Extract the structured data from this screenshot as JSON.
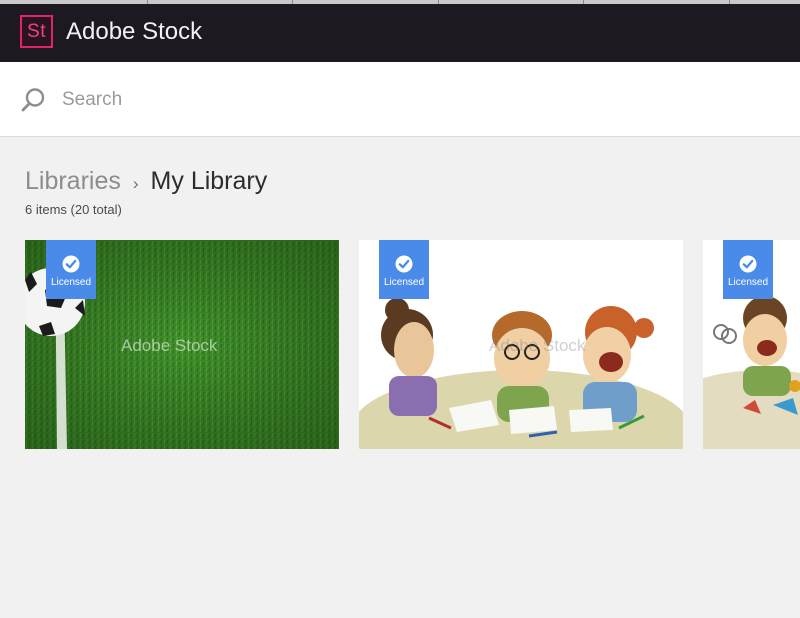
{
  "app": {
    "logo_text": "St",
    "title": "Adobe Stock",
    "brand_color": "#e0246c",
    "bar_color": "#1c1a20"
  },
  "search": {
    "placeholder": "Search",
    "value": ""
  },
  "breadcrumb": {
    "root": "Libraries",
    "separator": "›",
    "current": "My Library"
  },
  "library": {
    "count_text": "6 items (20 total)"
  },
  "assets": [
    {
      "badge": "Licensed",
      "watermark": "Adobe Stock",
      "subject": "soccer ball on grass"
    },
    {
      "badge": "Licensed",
      "watermark": "Adobe Stock",
      "subject": "children drawing illustration"
    },
    {
      "badge": "Licensed",
      "watermark": "",
      "subject": "child with scissors illustration"
    }
  ],
  "badge_color": "#4a8bea",
  "icons": [
    "search-icon",
    "check-icon"
  ]
}
